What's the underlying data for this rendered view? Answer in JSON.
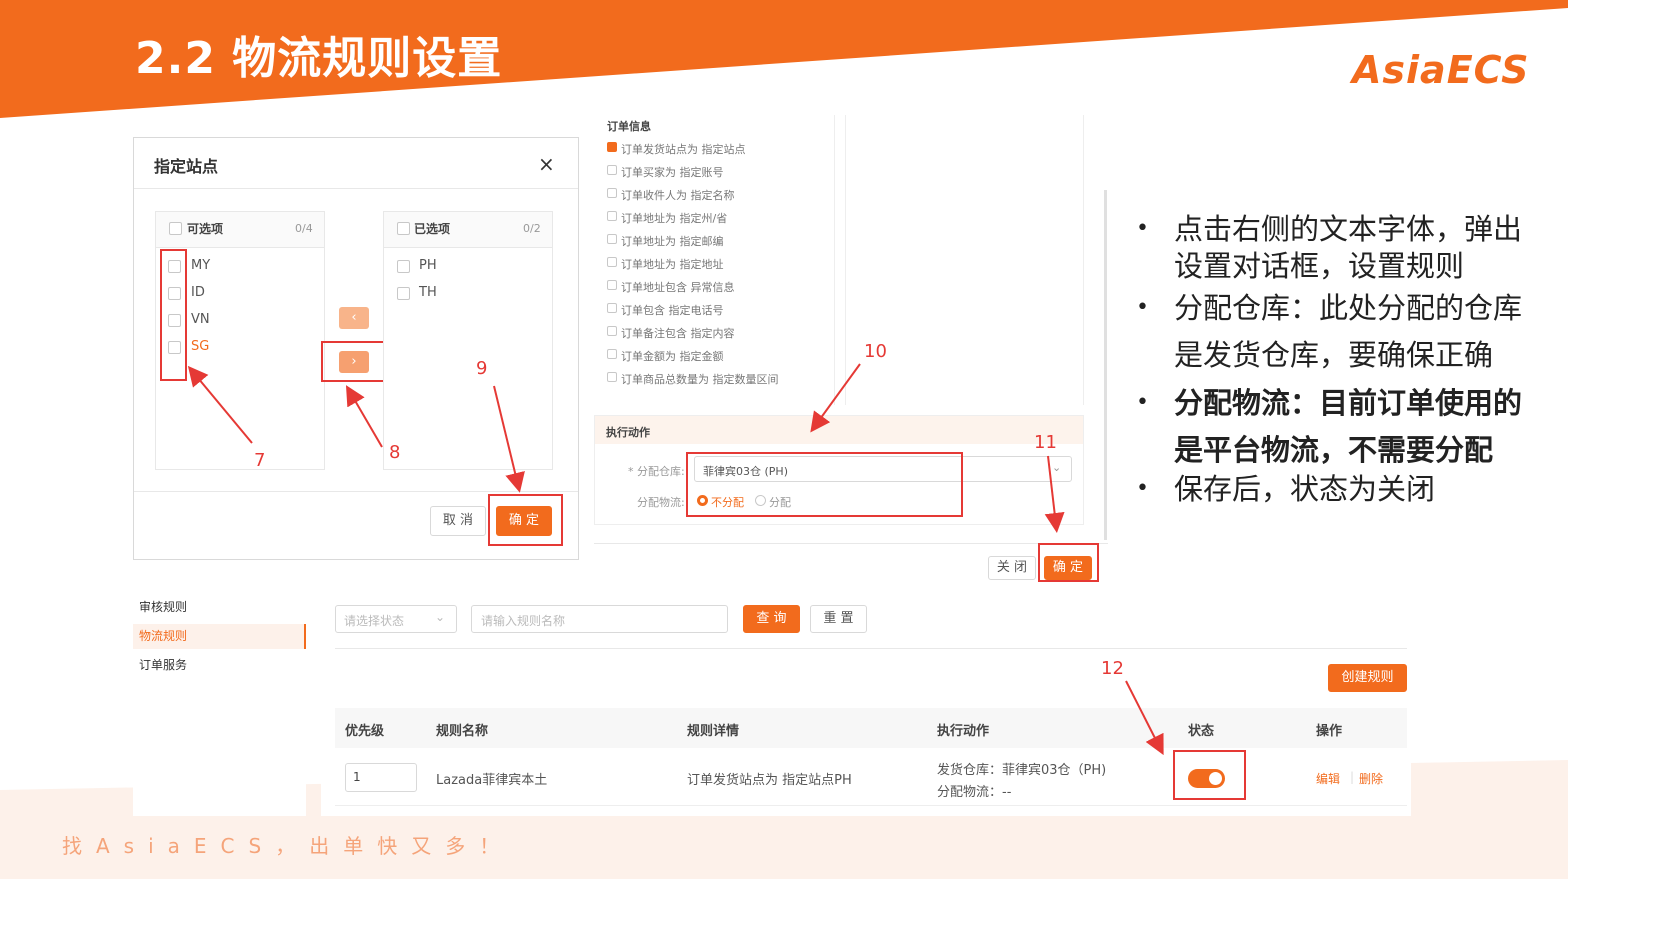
{
  "slide": {
    "title": "2.2 物流规则设置",
    "brand": "AsiaECS",
    "slogan": "找AsiaECS，出单快又多！"
  },
  "dialog": {
    "title": "指定站点",
    "close_icon": "×",
    "left_box": {
      "header": "可选项",
      "count": "0/4",
      "items": [
        "MY",
        "ID",
        "VN",
        "SG"
      ]
    },
    "right_box": {
      "header": "已选项",
      "count": "0/2",
      "items": [
        "PH",
        "TH"
      ]
    },
    "arrow_left": "‹",
    "arrow_right": "›",
    "cancel_label": "取 消",
    "ok_label": "确 定"
  },
  "order_info": {
    "heading": "订单信息",
    "conditions": [
      {
        "label": "订单发货站点为 指定站点",
        "checked": true
      },
      {
        "label": "订单买家为 指定账号",
        "checked": false
      },
      {
        "label": "订单收件人为 指定名称",
        "checked": false
      },
      {
        "label": "订单地址为 指定州/省",
        "checked": false
      },
      {
        "label": "订单地址为 指定邮编",
        "checked": false
      },
      {
        "label": "订单地址为 指定地址",
        "checked": false
      },
      {
        "label": "订单地址包含 异常信息",
        "checked": false
      },
      {
        "label": "订单包含 指定电话号",
        "checked": false
      },
      {
        "label": "订单备注包含 指定内容",
        "checked": false
      },
      {
        "label": "订单金额为 指定金额",
        "checked": false
      },
      {
        "label": "订单商品总数量为 指定数量区间",
        "checked": false
      }
    ]
  },
  "action": {
    "heading": "执行动作",
    "warehouse_label": "* 分配仓库:",
    "warehouse_value": "菲律宾03仓 (PH)",
    "logistics_label": "分配物流:",
    "option_no": "不分配",
    "option_yes": "分配",
    "close_label": "关 闭",
    "ok_label": "确 定"
  },
  "annotations": {
    "n7": "7",
    "n8": "8",
    "n9": "9",
    "n10": "10",
    "n11": "11",
    "n12": "12"
  },
  "bullets": [
    {
      "line1": "点击右侧的文本字体，弹出",
      "line2": "设置对话框，设置规则",
      "bold": false
    },
    {
      "line1": "分配仓库：此处分配的仓库",
      "line2": "是发货仓库，要确保正确",
      "bold": false
    },
    {
      "line1": "分配物流：目前订单使用的",
      "line2": "是平台物流，不需要分配",
      "bold": true
    },
    {
      "line1": "保存后，状态为关闭",
      "line2": "",
      "bold": false
    }
  ],
  "sidebar": {
    "items": [
      {
        "label": "审核规则",
        "active": false
      },
      {
        "label": "物流规则",
        "active": true
      },
      {
        "label": "订单服务",
        "active": false
      }
    ]
  },
  "filter": {
    "status_placeholder": "请选择状态",
    "name_placeholder": "请输入规则名称",
    "query_label": "查 询",
    "reset_label": "重 置",
    "create_label": "创建规则"
  },
  "table": {
    "columns": [
      "优先级",
      "规则名称",
      "规则详情",
      "执行动作",
      "状态",
      "操作"
    ],
    "rows": [
      {
        "priority": "1",
        "name": "Lazada菲律宾本土",
        "detail": "订单发货站点为 指定站点PH",
        "action_line1": "发货仓库：菲律宾03仓（PH)",
        "action_line2": "分配物流：--",
        "status_on": true,
        "edit": "编辑",
        "delete": "删除"
      }
    ]
  },
  "colors": {
    "accent": "#f26b1d",
    "annotation": "#e53935"
  }
}
